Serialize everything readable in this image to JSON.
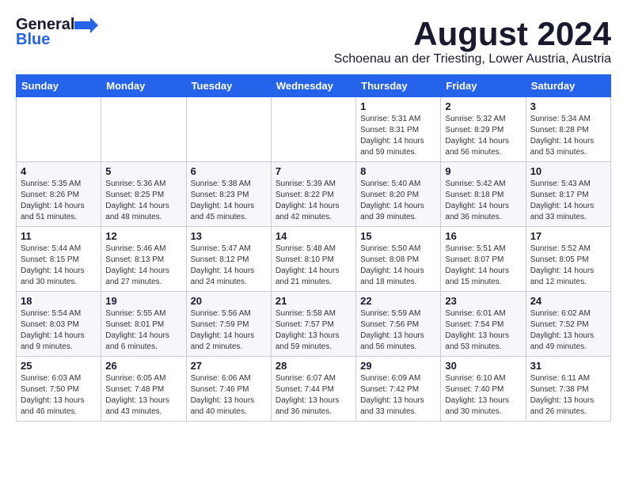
{
  "header": {
    "logo_general": "General",
    "logo_blue": "Blue",
    "month_title": "August 2024",
    "location": "Schoenau an der Triesting, Lower Austria, Austria"
  },
  "columns": [
    "Sunday",
    "Monday",
    "Tuesday",
    "Wednesday",
    "Thursday",
    "Friday",
    "Saturday"
  ],
  "weeks": [
    [
      {
        "day": "",
        "info": ""
      },
      {
        "day": "",
        "info": ""
      },
      {
        "day": "",
        "info": ""
      },
      {
        "day": "",
        "info": ""
      },
      {
        "day": "1",
        "info": "Sunrise: 5:31 AM\nSunset: 8:31 PM\nDaylight: 14 hours\nand 59 minutes."
      },
      {
        "day": "2",
        "info": "Sunrise: 5:32 AM\nSunset: 8:29 PM\nDaylight: 14 hours\nand 56 minutes."
      },
      {
        "day": "3",
        "info": "Sunrise: 5:34 AM\nSunset: 8:28 PM\nDaylight: 14 hours\nand 53 minutes."
      }
    ],
    [
      {
        "day": "4",
        "info": "Sunrise: 5:35 AM\nSunset: 8:26 PM\nDaylight: 14 hours\nand 51 minutes."
      },
      {
        "day": "5",
        "info": "Sunrise: 5:36 AM\nSunset: 8:25 PM\nDaylight: 14 hours\nand 48 minutes."
      },
      {
        "day": "6",
        "info": "Sunrise: 5:38 AM\nSunset: 8:23 PM\nDaylight: 14 hours\nand 45 minutes."
      },
      {
        "day": "7",
        "info": "Sunrise: 5:39 AM\nSunset: 8:22 PM\nDaylight: 14 hours\nand 42 minutes."
      },
      {
        "day": "8",
        "info": "Sunrise: 5:40 AM\nSunset: 8:20 PM\nDaylight: 14 hours\nand 39 minutes."
      },
      {
        "day": "9",
        "info": "Sunrise: 5:42 AM\nSunset: 8:18 PM\nDaylight: 14 hours\nand 36 minutes."
      },
      {
        "day": "10",
        "info": "Sunrise: 5:43 AM\nSunset: 8:17 PM\nDaylight: 14 hours\nand 33 minutes."
      }
    ],
    [
      {
        "day": "11",
        "info": "Sunrise: 5:44 AM\nSunset: 8:15 PM\nDaylight: 14 hours\nand 30 minutes."
      },
      {
        "day": "12",
        "info": "Sunrise: 5:46 AM\nSunset: 8:13 PM\nDaylight: 14 hours\nand 27 minutes."
      },
      {
        "day": "13",
        "info": "Sunrise: 5:47 AM\nSunset: 8:12 PM\nDaylight: 14 hours\nand 24 minutes."
      },
      {
        "day": "14",
        "info": "Sunrise: 5:48 AM\nSunset: 8:10 PM\nDaylight: 14 hours\nand 21 minutes."
      },
      {
        "day": "15",
        "info": "Sunrise: 5:50 AM\nSunset: 8:08 PM\nDaylight: 14 hours\nand 18 minutes."
      },
      {
        "day": "16",
        "info": "Sunrise: 5:51 AM\nSunset: 8:07 PM\nDaylight: 14 hours\nand 15 minutes."
      },
      {
        "day": "17",
        "info": "Sunrise: 5:52 AM\nSunset: 8:05 PM\nDaylight: 14 hours\nand 12 minutes."
      }
    ],
    [
      {
        "day": "18",
        "info": "Sunrise: 5:54 AM\nSunset: 8:03 PM\nDaylight: 14 hours\nand 9 minutes."
      },
      {
        "day": "19",
        "info": "Sunrise: 5:55 AM\nSunset: 8:01 PM\nDaylight: 14 hours\nand 6 minutes."
      },
      {
        "day": "20",
        "info": "Sunrise: 5:56 AM\nSunset: 7:59 PM\nDaylight: 14 hours\nand 2 minutes."
      },
      {
        "day": "21",
        "info": "Sunrise: 5:58 AM\nSunset: 7:57 PM\nDaylight: 13 hours\nand 59 minutes."
      },
      {
        "day": "22",
        "info": "Sunrise: 5:59 AM\nSunset: 7:56 PM\nDaylight: 13 hours\nand 56 minutes."
      },
      {
        "day": "23",
        "info": "Sunrise: 6:01 AM\nSunset: 7:54 PM\nDaylight: 13 hours\nand 53 minutes."
      },
      {
        "day": "24",
        "info": "Sunrise: 6:02 AM\nSunset: 7:52 PM\nDaylight: 13 hours\nand 49 minutes."
      }
    ],
    [
      {
        "day": "25",
        "info": "Sunrise: 6:03 AM\nSunset: 7:50 PM\nDaylight: 13 hours\nand 46 minutes."
      },
      {
        "day": "26",
        "info": "Sunrise: 6:05 AM\nSunset: 7:48 PM\nDaylight: 13 hours\nand 43 minutes."
      },
      {
        "day": "27",
        "info": "Sunrise: 6:06 AM\nSunset: 7:46 PM\nDaylight: 13 hours\nand 40 minutes."
      },
      {
        "day": "28",
        "info": "Sunrise: 6:07 AM\nSunset: 7:44 PM\nDaylight: 13 hours\nand 36 minutes."
      },
      {
        "day": "29",
        "info": "Sunrise: 6:09 AM\nSunset: 7:42 PM\nDaylight: 13 hours\nand 33 minutes."
      },
      {
        "day": "30",
        "info": "Sunrise: 6:10 AM\nSunset: 7:40 PM\nDaylight: 13 hours\nand 30 minutes."
      },
      {
        "day": "31",
        "info": "Sunrise: 6:11 AM\nSunset: 7:38 PM\nDaylight: 13 hours\nand 26 minutes."
      }
    ]
  ]
}
